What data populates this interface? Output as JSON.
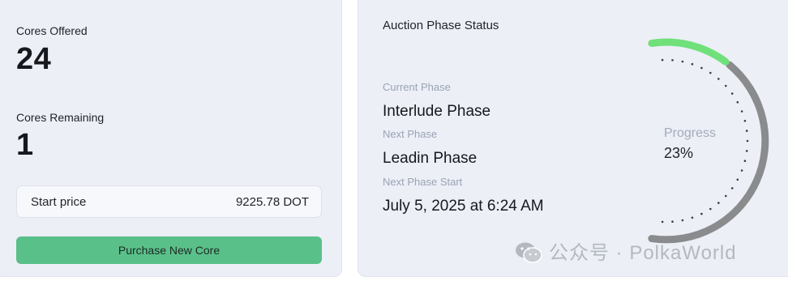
{
  "left": {
    "cores_offered_label": "Cores Offered",
    "cores_offered_value": "24",
    "cores_remaining_label": "Cores Remaining",
    "cores_remaining_value": "1",
    "start_price_label": "Start price",
    "start_price_value": "9225.78 DOT",
    "purchase_button": "Purchase New Core"
  },
  "right": {
    "title": "Auction Phase Status",
    "current_phase_label": "Current Phase",
    "current_phase_value": "Interlude Phase",
    "next_phase_label": "Next Phase",
    "next_phase_value": "Leadin Phase",
    "next_phase_start_label": "Next Phase Start",
    "next_phase_start_value": "July 5, 2025 at 6:24 AM",
    "progress_label": "Progress",
    "progress_value": "23%",
    "progress_fraction": 0.23
  },
  "watermark": {
    "text": "公众号 · PolkaWorld",
    "icon": "wechat-icon"
  },
  "colors": {
    "card_bg": "#eceff6",
    "accent_green": "#5ac08a",
    "progress_green": "#6fe07a",
    "track_gray": "#8a8b8d",
    "muted_text": "#9aa3b5"
  }
}
